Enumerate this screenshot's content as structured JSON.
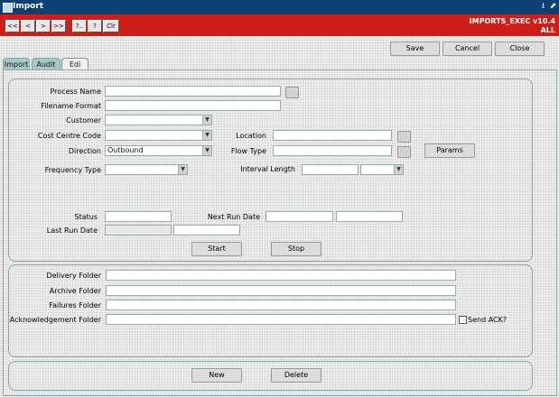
{
  "window": {
    "title": "Import",
    "minimize_glyph": "⭳",
    "maximize_glyph": "⬈"
  },
  "nav": {
    "first": "<<",
    "prev": "<",
    "next": ">",
    "last": ">>",
    "help1": "?..",
    "help2": "?",
    "clear": "Clr"
  },
  "app_id": {
    "line1": "IMPORTS_EXEC v10.4",
    "line2": "ALL"
  },
  "actions": {
    "save": "Save",
    "cancel": "Cancel",
    "close": "Close"
  },
  "tabs": [
    {
      "label": "Import"
    },
    {
      "label": "Audit"
    },
    {
      "label": "Edi"
    }
  ],
  "form": {
    "process_name": {
      "label": "Process Name",
      "value": ""
    },
    "filename_format": {
      "label": "Filename Format",
      "value": ""
    },
    "customer": {
      "label": "Customer",
      "value": ""
    },
    "cost_centre_code": {
      "label": "Cost Centre Code",
      "value": ""
    },
    "location": {
      "label": "Location",
      "value": ""
    },
    "direction": {
      "label": "Direction",
      "value": "Outbound"
    },
    "flow_type": {
      "label": "Flow Type",
      "value": ""
    },
    "params_button": "Params",
    "frequency_type": {
      "label": "Frequency Type",
      "value": ""
    },
    "interval_length": {
      "label": "Interval Length",
      "value": "",
      "unit": ""
    },
    "status": {
      "label": "Status",
      "value": ""
    },
    "next_run_date": {
      "label": "Next Run Date",
      "date": "",
      "time": ""
    },
    "last_run_date": {
      "label": "Last Run Date",
      "date": "",
      "time": ""
    },
    "start_button": "Start",
    "stop_button": "Stop"
  },
  "folders": {
    "delivery": {
      "label": "Delivery Folder",
      "value": ""
    },
    "archive": {
      "label": "Archive Folder",
      "value": ""
    },
    "failures": {
      "label": "Failures Folder",
      "value": ""
    },
    "acknowledgement": {
      "label": "Acknowledgement Folder",
      "value": ""
    },
    "send_ack": {
      "label": "Send ACK?",
      "checked": false
    }
  },
  "bottom": {
    "new": "New",
    "delete": "Delete"
  },
  "colors": {
    "titlebar": "#0e3f73",
    "toolbar": "#cc1f1a",
    "tab_inactive": "#a6c9c6",
    "panel_border": "#7fa9a6"
  }
}
